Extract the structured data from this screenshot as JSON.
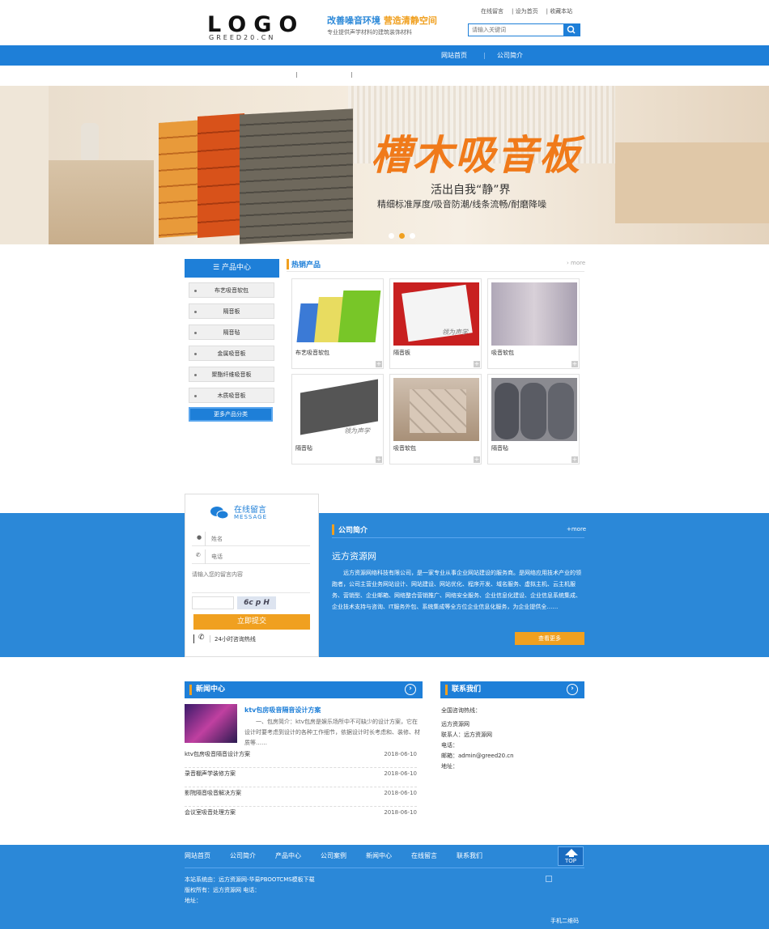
{
  "header": {
    "logo_word": "LOGO",
    "logo_sub": "GREED20.CN",
    "slogan_main": "改善噪音环境",
    "slogan_accent": "营造清静空间",
    "slogan_sub": "专业提供声学材料的建筑装饰材料",
    "top_links": [
      "在线留言",
      "设为首页",
      "收藏本站"
    ],
    "search_placeholder": "请输入关键词"
  },
  "nav": {
    "items": [
      "网站首页",
      "公司简介"
    ]
  },
  "banner": {
    "title": "槽木吸音板",
    "line1": "活出自我“静”界",
    "line2": "精细标准厚度/吸音防潮/线条流畅/耐磨降噪",
    "dots": 3,
    "active_dot": 2
  },
  "sidebar": {
    "title": "产品中心",
    "items": [
      "布艺吸音软包",
      "隔音板",
      "隔音毡",
      "金属吸音板",
      "聚酯纤维吸音板",
      "木质吸音板"
    ],
    "more": "更多产品分类"
  },
  "hot": {
    "title": "热销产品",
    "more": "more",
    "products": [
      "布艺吸音软包",
      "隔音板",
      "吸音软包",
      "隔音毡",
      "吸音软包",
      "隔音毡"
    ],
    "watermark": "领为声学"
  },
  "message": {
    "title": "在线留言",
    "title_en": "MESSAGE",
    "name_ph": "姓名",
    "phone_ph": "电话",
    "content_ph": "请输入您的留言内容",
    "captcha": "6c p H",
    "submit": "立即提交",
    "hotline_label": "24小时咨询热线"
  },
  "about": {
    "title": "公司简介",
    "more": "+more",
    "company": "远方资源网",
    "text": "远方资源网络科技有限公司，是一家专业从事企业网站建设的服务商。是网络应用技术产业的领跑者，公司主营业务网站设计、网站建设、网站优化、程序开发、域名服务、虚拟主机、云主机服务、营销型、企业邮箱、网络整合营销推广、网络安全服务、企业信息化建设、企业信息系统集成、企业技术支持与咨询、IT服务外包、系统集成等全方位企业信息化服务，为企业提供全……",
    "btn": "查看更多"
  },
  "news": {
    "title": "新闻中心",
    "featured_title": "ktv包房吸音隔音设计方案",
    "featured_text": "一、包房简介：ktv包房是娱乐场所中不可缺少的设计方案，它在设计时要考虑到设计的各种工作细节，依据设计时长考虑和、装修、材质等……",
    "items": [
      {
        "title": "ktv包房吸音隔音设计方案",
        "date": "2018-06-10"
      },
      {
        "title": "录音棚声学装修方案",
        "date": "2018-06-10"
      },
      {
        "title": "影院隔音吸音解决方案",
        "date": "2018-06-10"
      },
      {
        "title": "会议室吸音处理方案",
        "date": "2018-06-10"
      }
    ]
  },
  "contact": {
    "title": "联系我们",
    "hotline": "全国咨询热线：",
    "company": "远方资源网",
    "person": "联系人：远方资源网",
    "phone": "电话：",
    "email": "邮箱：admin@greed20.cn",
    "address": "地址："
  },
  "footer": {
    "nav": [
      "网站首页",
      "公司简介",
      "产品中心",
      "公司案例",
      "新闻中心",
      "在线留言",
      "联系我们"
    ],
    "top": "TOP",
    "copyright": "本站系统由：远方资源网-华易PBOOTCMS模板下载",
    "rights": "版权所有：远方资源网 电话：",
    "addr": "地址：",
    "mobile": "手机二维码"
  },
  "colors": {
    "primary": "#1e7fd8",
    "band": "#2b88d8",
    "accent": "#f0a020"
  }
}
